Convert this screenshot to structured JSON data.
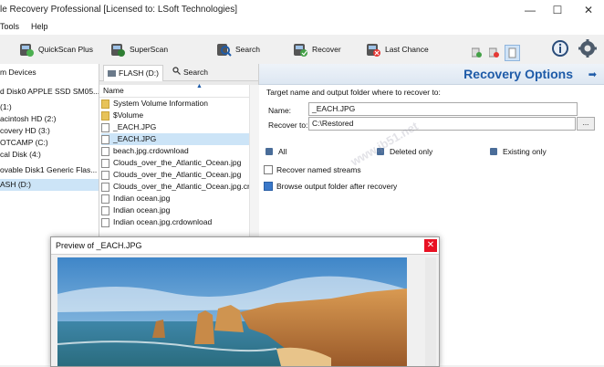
{
  "window": {
    "title": "le Recovery Professional [Licensed to: LSoft Technologies]",
    "controls": [
      "—",
      "☐",
      "✕"
    ]
  },
  "menu": {
    "items": [
      "Tools",
      "Help"
    ]
  },
  "toolbar": {
    "quickscan_plus": "QuickScan Plus",
    "superscan": "SuperScan",
    "search": "Search",
    "recover": "Recover",
    "last_chance": "Last Chance"
  },
  "devices": {
    "header": "m Devices",
    "items": [
      "d Disk0 APPLE SSD SM05...",
      "(1:)",
      "acintosh HD (2:)",
      "covery HD (3:)",
      "OTCAMP (C:)",
      "cal Disk (4:)",
      "ovable Disk1 Generic Flas...",
      "ASH (D:)"
    ],
    "selected_index": 7
  },
  "middle": {
    "tab_active": "FLASH (D:)",
    "tab_search": "Search",
    "column_name": "Name",
    "files": [
      {
        "name": "System Volume Information",
        "icon": "folder-icon"
      },
      {
        "name": "$Volume",
        "icon": "folder-icon"
      },
      {
        "name": "_EACH.JPG",
        "icon": "file-icon"
      },
      {
        "name": "_EACH.JPG",
        "icon": "file-icon"
      },
      {
        "name": "beach.jpg.crdownload",
        "icon": "file-icon"
      },
      {
        "name": "Clouds_over_the_Atlantic_Ocean.jpg",
        "icon": "file-icon"
      },
      {
        "name": "Clouds_over_the_Atlantic_Ocean.jpg",
        "icon": "file-icon"
      },
      {
        "name": "Clouds_over_the_Atlantic_Ocean.jpg.crdc",
        "icon": "file-icon"
      },
      {
        "name": "Indian ocean.jpg",
        "icon": "file-icon"
      },
      {
        "name": "Indian ocean.jpg",
        "icon": "file-icon"
      },
      {
        "name": "Indian ocean.jpg.crdownload",
        "icon": "file-icon"
      }
    ],
    "selected_index": 3
  },
  "recovery": {
    "title": "Recovery Options",
    "target_label": "Target name and output folder where to recover to:",
    "name_label": "Name:",
    "name_value": "_EACH.JPG",
    "recover_to_label": "Recover to:",
    "recover_to_value": "C:\\Restored",
    "browse_label": "...",
    "filter_all": "All",
    "filter_deleted": "Deleted only",
    "filter_existing": "Existing only",
    "opt_streams": "Recover named streams",
    "opt_streams_checked": false,
    "opt_browse": "Browse output folder after recovery",
    "opt_browse_checked": true
  },
  "preview": {
    "title": "Preview of _EACH.JPG",
    "close": "✕"
  },
  "watermark": "www.jb51.net"
}
